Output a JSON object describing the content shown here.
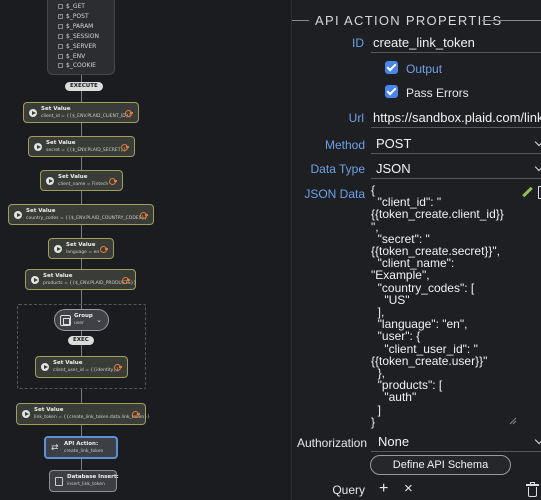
{
  "flow": {
    "variables": [
      "$_GET",
      "$_POST",
      "$_PARAM",
      "$_SESSION",
      "$_SERVER",
      "$_ENV",
      "$_COOKIE"
    ],
    "execute_label": "EXECUTE",
    "exec_label": "EXEC",
    "set_nodes": [
      {
        "title": "Set Value",
        "sub": "client_id = {{$_ENV.PLAID_CLIENT_ID}}"
      },
      {
        "title": "Set Value",
        "sub": "secret = {{$_ENV.PLAID_SECRET}}"
      },
      {
        "title": "Set Value",
        "sub": "client_name = Fintech"
      },
      {
        "title": "Set Value",
        "sub": "country_codes = {{$_ENV.PLAID_COUNTRY_CODES}}"
      },
      {
        "title": "Set Value",
        "sub": "language = en"
      },
      {
        "title": "Set Value",
        "sub": "products = {{$_ENV.PLAID_PRODUCTS}}"
      },
      {
        "title": "Set Value",
        "sub": "client_user_id = {{identity}}"
      },
      {
        "title": "Set Value",
        "sub": "link_token = {{create_link_token.data.link_token}}"
      }
    ],
    "group": {
      "title": "Group",
      "sub": "user"
    },
    "api_node": {
      "title": "API Action:",
      "sub": "create_link_token"
    },
    "db_node": {
      "title": "Database Insert:",
      "sub": "insert_link_token"
    }
  },
  "panel": {
    "title": "API ACTION PROPERTIES",
    "id_label": "ID",
    "id_value": "create_link_token",
    "output_label": "Output",
    "output_checked": true,
    "pass_errors_label": "Pass Errors",
    "pass_errors_checked": true,
    "url_label": "Url",
    "url_value": "https://sandbox.plaid.com/link/t",
    "method_label": "Method",
    "method_value": "POST",
    "data_type_label": "Data Type",
    "data_type_value": "JSON",
    "json_label": "JSON Data",
    "json_value": "{\n  \"client_id\": \"\n{{token_create.client_id}}\n\",\n  \"secret\": \"\n{{token_create.secret}}\",\n  \"client_name\":\n\"Example\",\n  \"country_codes\": [\n    \"US\"\n  ],\n  \"language\": \"en\",\n  \"user\": {\n    \"client_user_id\": \"\n{{token_create.user}}\"\n  },\n  \"products\": [\n    \"auth\"\n  ]\n}",
    "authorization_label": "Authorization",
    "authorization_value": "None",
    "define_schema_label": "Define API Schema",
    "query_label": "Query",
    "accent_color": "#4a86e8",
    "label_color": "#6da1e8"
  }
}
